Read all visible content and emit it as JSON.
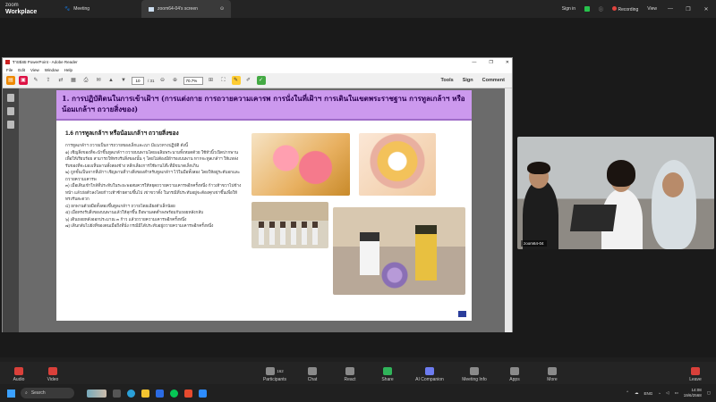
{
  "zoom_topbar": {
    "logo_zoom": "zoom",
    "logo_workplace": "Workplace",
    "tab_meeting": "Meeting",
    "tab_screen": "zoom64-04's screen",
    "sign_in": "Sign in",
    "recording": "Recording",
    "view": "View"
  },
  "reader": {
    "title": "รายย่อย PowerPoint - Adobe Reader",
    "menu": [
      "File",
      "Edit",
      "View",
      "Window",
      "Help"
    ],
    "page_current": "10",
    "page_total": "/ 31",
    "zoom_level": "70.7%",
    "right_tools": [
      "Tools",
      "Sign",
      "Comment"
    ]
  },
  "slide": {
    "header": "1. การปฏิบัติตนในการเข้าเฝ้าฯ (การแต่งกาย การถวายความเคารพ การนั่งในที่เฝ้าฯ การเดินในเขตพระราชฐาน การทูลเกล้าฯ หรือน้อมเกล้าฯ ถวายสิ่งของ)",
    "subheading": "1.6 การทูลเกล้าฯ หรือน้อมเกล้าฯ ถวายสิ่งของ",
    "body": [
      "การทูลเกล้าฯ ถวายเป็นการถวายของเล็กและเบา มีแนวทางปฏิบัติ ดังนี้",
      "๑) เชิญสิ่งของที่จะนำขึ้นทูลเกล้าฯ ถวายบนพานโดยเฉลิมพระนามทั้งหมดด้วย ใช้หัวนิ้วเปิดปากพาน เพื่อให้เรียบร้อย สามารถให้ทรงรับสิ่งของนั้น ๆ โดยไม่ต้องมีผ้ารองบนพาน หากจะทูลเกล้าฯ ให้แหล่งรับของที่จะมองเห็นพานทั้งสองข้าง หลีกเลี่ยงการใช้พานโต๊ะที่มีขนาดเล็กเกิน",
      "๒) ถูกขั้นเป็นจากที่เฝ้าฯ เชิญพานที่วางสิ่งของสำหรับทูลเกล้าฯ ไว้ในมือทั้งสอง โดยให้อยู่ระดับอกและถวายความเคารพ",
      "๓) เมื่อเดินเข้าใกล้ที่ประทับในระยะพอสมควรให้หยุดถวายความเคารพอีกครั้งหนึ่ง ก้าวเท้าขวาไปข้างหน้า แล้วถ่อตัวลงโดยก้าวเท้าซ้ายตามขึ้นไป เข่าขวาตั้ง ในกรณีที่ประทับอยู่จะต้องคุกเข่าขึ้นเพื่อให้ทรงรับสะดวก",
      "๔) ยกพานด้วยมือทั้งสองขึ้นทูลเกล้าฯ ถวายโดยเอียงตัวเล็กน้อย",
      "๕) เมื่อทรงรับสิ่งของบนพานแล้วให้ลุกขึ้น ถือพานลดต่ำลงพร้อมกับถอยหลังกลับ",
      "๖) เดินถอยหลังออกประมาณ ๓ ก้าว แล้วถวายความเคารพอีกครั้งหนึ่ง",
      "๗) เดินกลับไปยังที่ของตนเมื่อถึงที่นั่ง กรณีมิได้ประทับอยู่ถวายความเคารพอีกครั้งหนึ่ง"
    ]
  },
  "video": {
    "name": "zoom64-04"
  },
  "zoom_bottombar": {
    "audio": "Audio",
    "video": "Video",
    "participants": "Participants",
    "participants_count": "162",
    "chat": "Chat",
    "react": "React",
    "share": "Share",
    "ai_companion": "AI Companion",
    "meeting_info": "Meeting Info",
    "apps": "Apps",
    "more": "More",
    "leave": "Leave"
  },
  "taskbar": {
    "search": "Search",
    "lang": "ENG",
    "time": "14:08",
    "date": "19/6/2568"
  },
  "colors": {
    "slide_header_bg": "#cc99ee",
    "zoom_leave_red": "#d9403a",
    "zoom_share_green": "#30b45a"
  }
}
